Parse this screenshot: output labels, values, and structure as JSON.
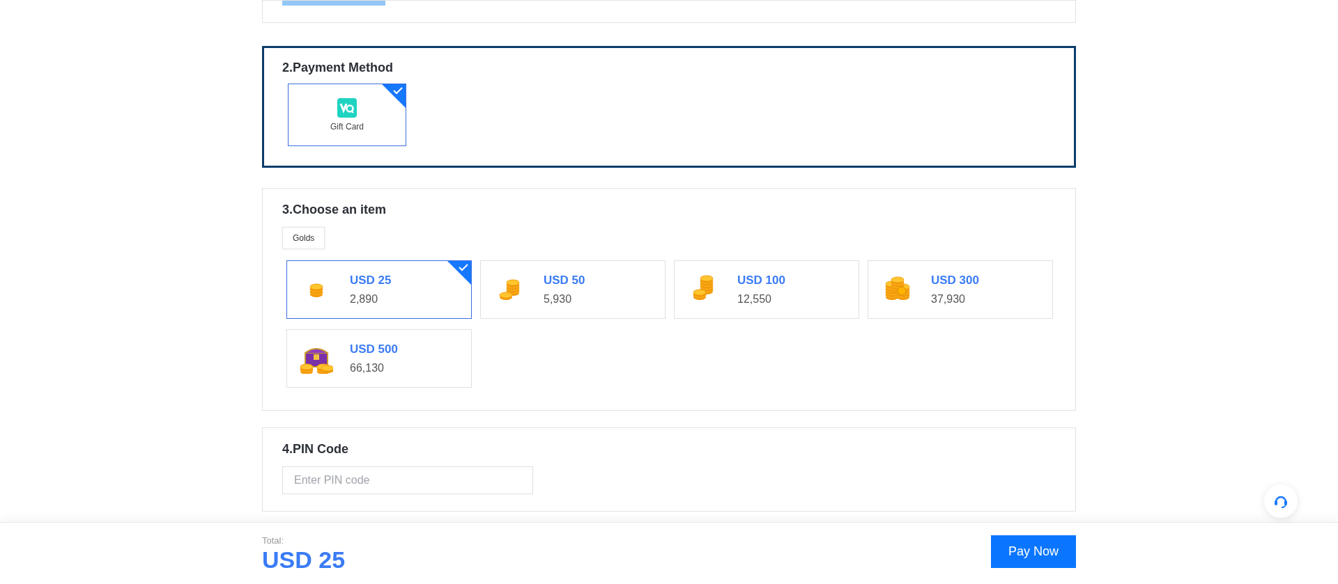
{
  "payment_method": {
    "title": "2.Payment Method",
    "focused": true,
    "methods": [
      {
        "label": "Gift Card",
        "selected": true
      }
    ]
  },
  "choose_item": {
    "title": "3.Choose an item",
    "tabs": [
      {
        "label": "Golds",
        "selected": true
      }
    ],
    "items": [
      {
        "kind": "coins-small",
        "price": "USD 25",
        "amount": "2,890",
        "selected": true
      },
      {
        "kind": "coins-medium",
        "price": "USD 50",
        "amount": "5,930",
        "selected": false
      },
      {
        "kind": "coins-large",
        "price": "USD 100",
        "amount": "12,550",
        "selected": false
      },
      {
        "kind": "coins-pile",
        "price": "USD 300",
        "amount": "37,930",
        "selected": false
      },
      {
        "kind": "chest",
        "price": "USD 500",
        "amount": "66,130",
        "selected": false
      }
    ]
  },
  "pin_code": {
    "title": "4.PIN Code",
    "placeholder": "Enter PIN code"
  },
  "footer": {
    "total_label": "Total:",
    "total": "USD 25",
    "button": "Pay Now"
  }
}
